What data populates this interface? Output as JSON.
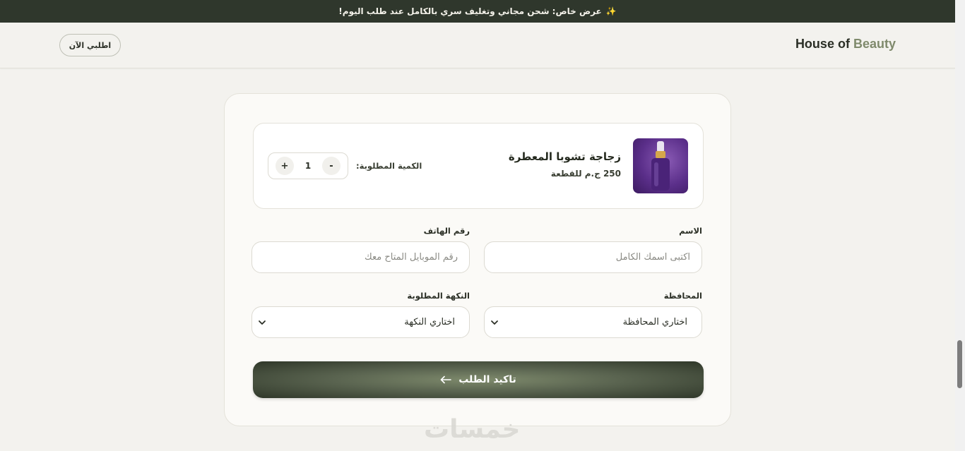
{
  "announcement": {
    "icon": "sparkle-icon",
    "text": "عرض خاص: شحن مجاني وتغليف سري بالكامل عند طلب اليوم!"
  },
  "header": {
    "brand_part1": "House of",
    "brand_part2": "Beauty",
    "order_now_label": "اطلبي الآن"
  },
  "product": {
    "name": "زجاجة تشوبا المعطرة",
    "price": "250 ج.م للقطعة",
    "quantity_label": "الكمية المطلوبة:",
    "quantity": "1",
    "increment_label": "+",
    "decrement_label": "-"
  },
  "form": {
    "name_label": "الاسم",
    "name_placeholder": "اكتبى اسمك الكامل",
    "phone_label": "رقم الهاتف",
    "phone_placeholder": "رقم الموبايل المتاح معك",
    "governorate_label": "المحافظة",
    "governorate_value": "اختاري المحافظة",
    "flavor_label": "النكهة المطلوبة",
    "flavor_value": "اختاري النكهة"
  },
  "confirm": {
    "label": "تاكيد الطلب",
    "icon": "arrow-left-icon"
  },
  "watermark": {
    "text": "خمسات"
  },
  "colors": {
    "dark": "#2f372c",
    "accent": "#7f8a6c",
    "background": "#f3f2ee"
  }
}
